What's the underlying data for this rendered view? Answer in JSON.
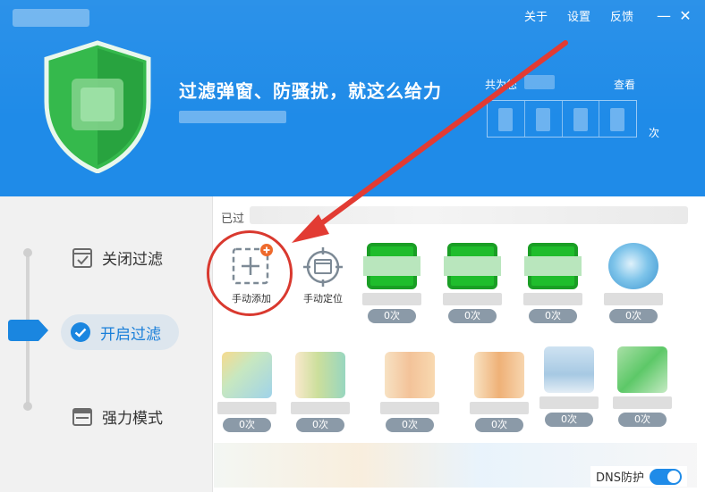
{
  "header": {
    "nav": {
      "about": "关于",
      "settings": "设置",
      "feedback": "反馈"
    },
    "window": {
      "minimize": "—",
      "close": "✕"
    },
    "slogan": "过滤弹窗、防骚扰，就这么给力",
    "stats_label": "共为您",
    "view_label": "查看",
    "times_unit": "次"
  },
  "modes": {
    "close": "关闭过滤",
    "open": "开启过滤",
    "force": "强力模式"
  },
  "main": {
    "blocked_label": "已过",
    "tools": {
      "add": "手动添加",
      "locate": "手动定位"
    },
    "row1_counts": [
      "0次",
      "0次",
      "0次",
      "0次"
    ],
    "row2_counts": [
      "0次",
      "0次",
      "0次",
      "0次",
      "0次",
      "0次"
    ],
    "dns_label": "DNS防护"
  },
  "colors": {
    "accent": "#1f8be8",
    "shield": "#2db34a",
    "highlight_red": "#d9392f",
    "count_badge": "#8b9aa8"
  }
}
